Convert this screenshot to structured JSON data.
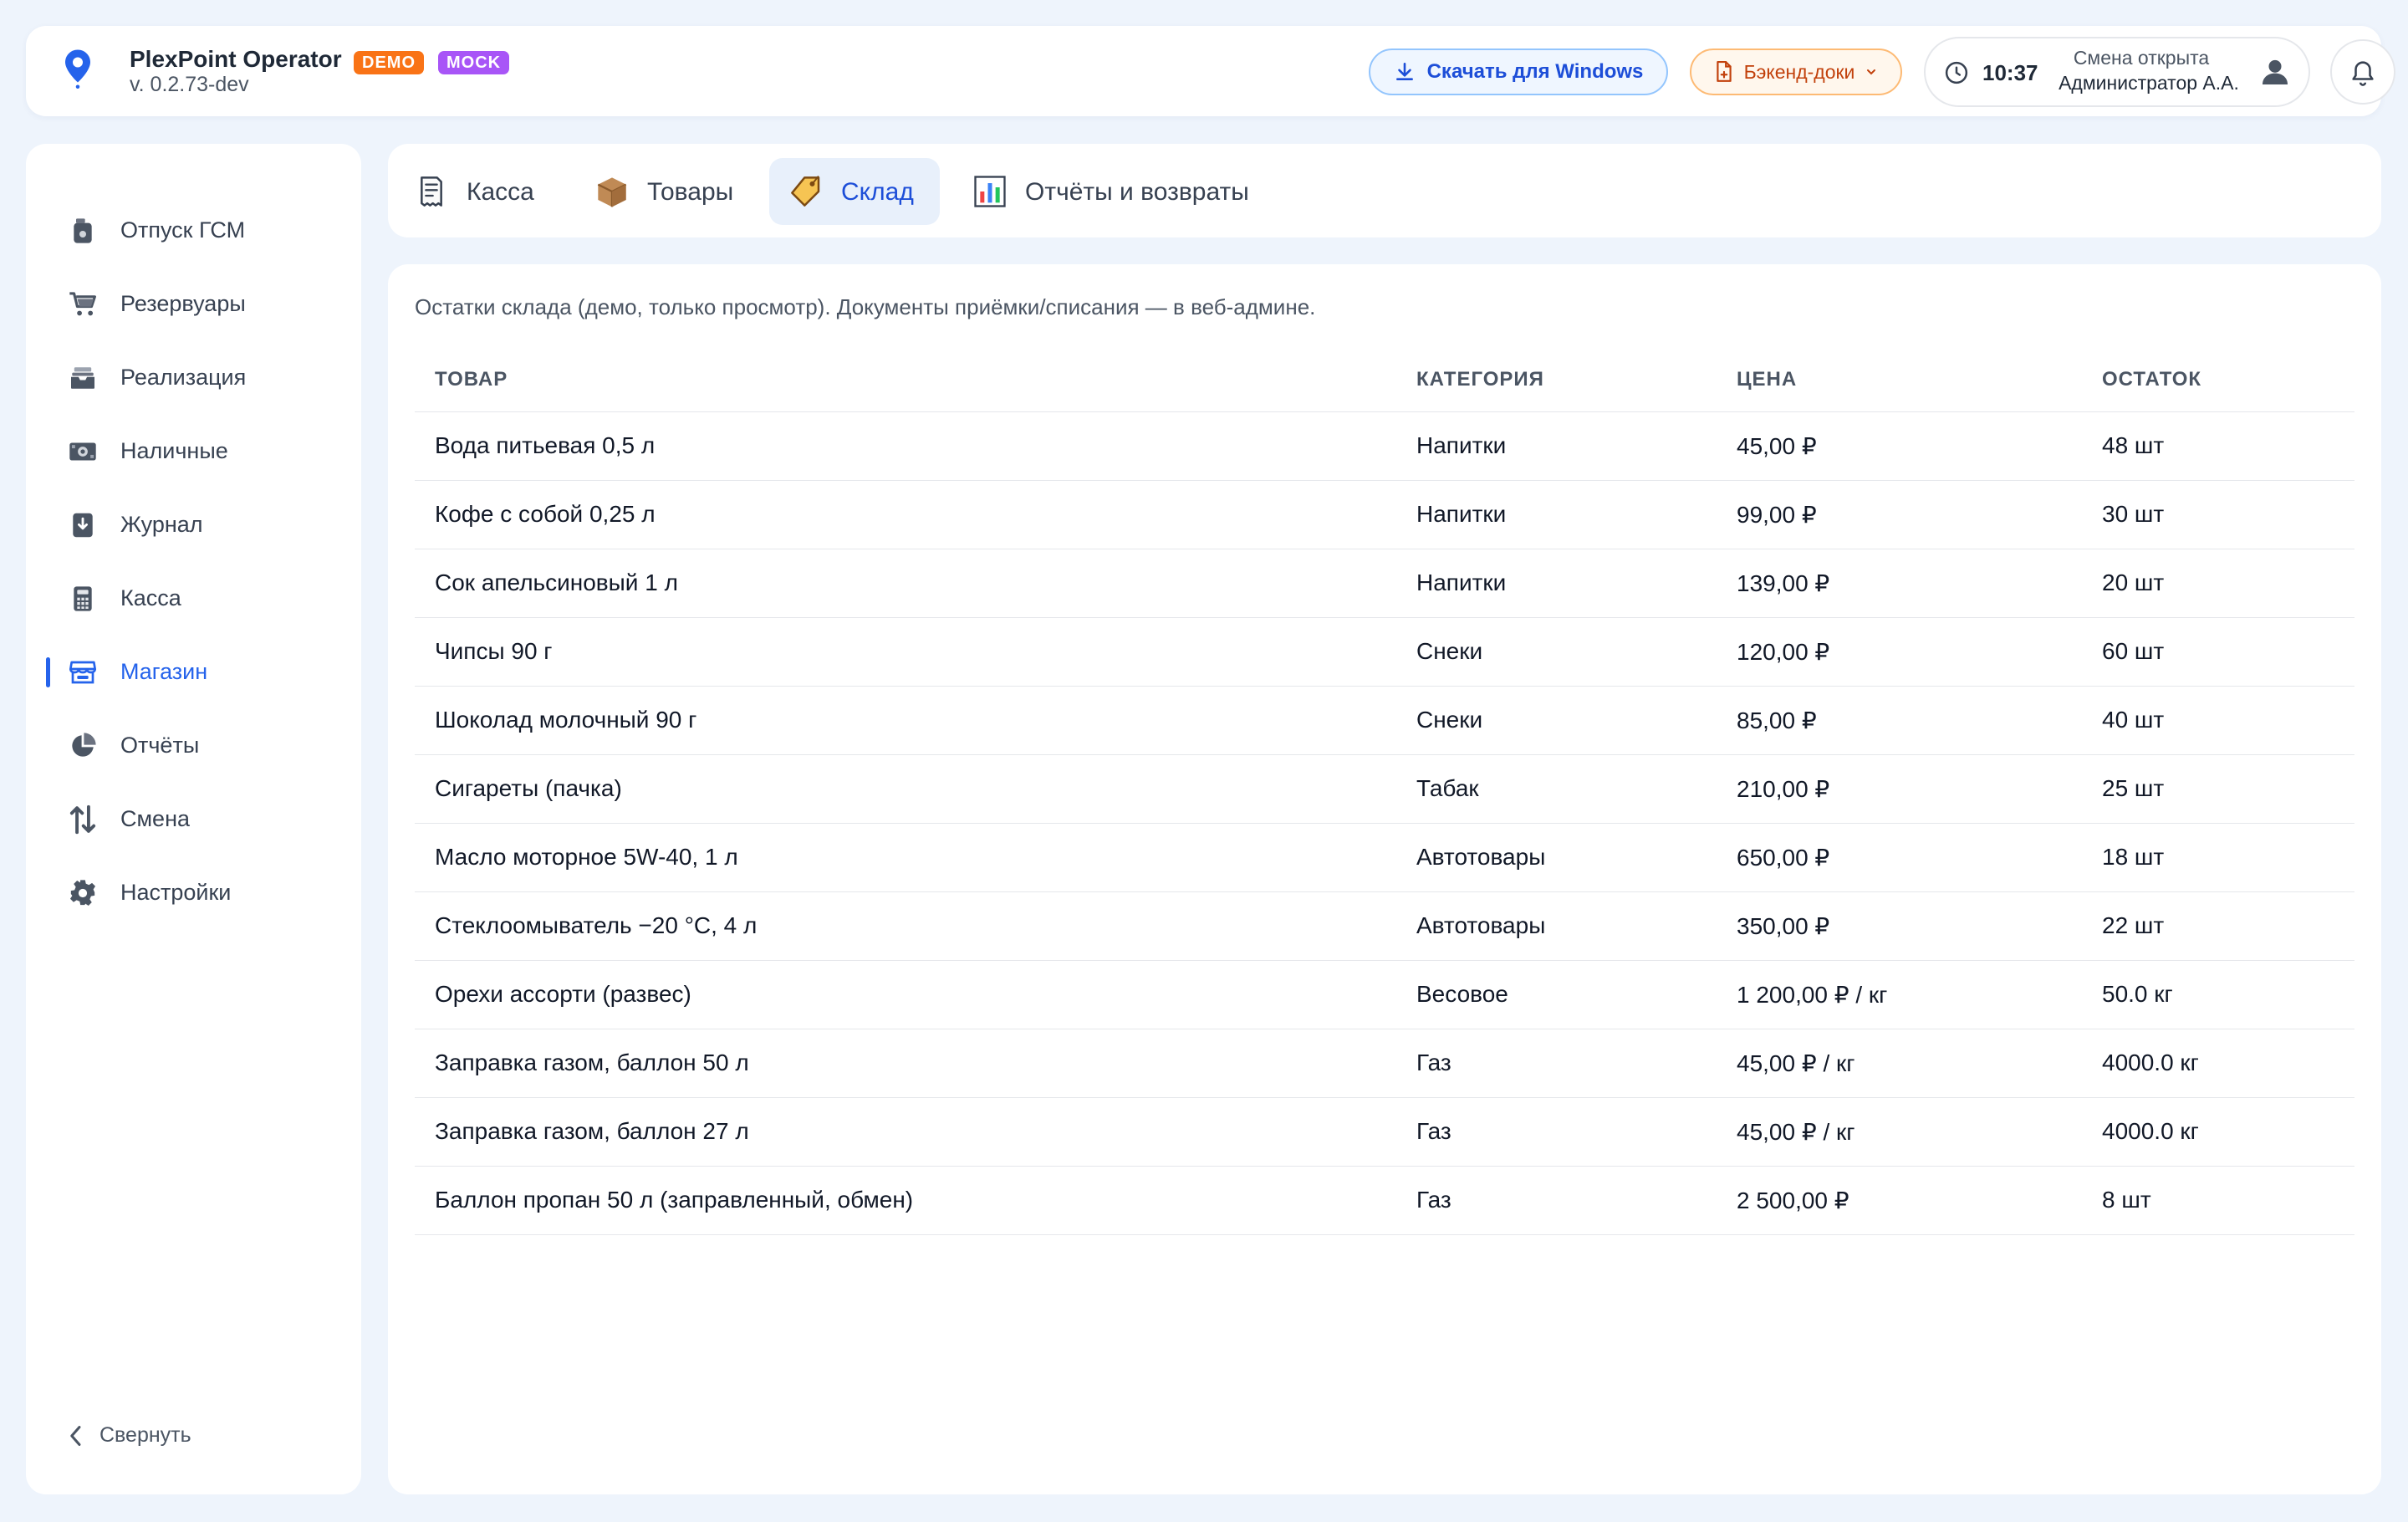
{
  "header": {
    "app_title": "PlexPoint Operator",
    "badge_demo": "DEMO",
    "badge_mock": "MOCK",
    "version": "v. 0.2.73-dev",
    "download_label": "Скачать для Windows",
    "docs_label": "Бэкенд-доки",
    "time": "10:37",
    "shift_status": "Смена открыта",
    "shift_user": "Администратор А.А.",
    "icons": {
      "logo": "map-pin-icon",
      "download": "download-icon",
      "docs": "document-icon",
      "clock": "clock-icon",
      "user": "user-icon",
      "bell": "bell-icon"
    }
  },
  "sidebar": {
    "items": [
      {
        "label": "Отпуск ГСМ",
        "icon": "fuel-canister-icon",
        "active": false
      },
      {
        "label": "Резервуары",
        "icon": "cart-icon",
        "active": false
      },
      {
        "label": "Реализация",
        "icon": "inbox-tray-icon",
        "active": false
      },
      {
        "label": "Наличные",
        "icon": "cash-icon",
        "active": false
      },
      {
        "label": "Журнал",
        "icon": "journal-icon",
        "active": false
      },
      {
        "label": "Касса",
        "icon": "calculator-icon",
        "active": false
      },
      {
        "label": "Магазин",
        "icon": "store-icon",
        "active": true
      },
      {
        "label": "Отчёты",
        "icon": "pie-chart-icon",
        "active": false
      },
      {
        "label": "Смена",
        "icon": "swap-arrows-icon",
        "active": false
      },
      {
        "label": "Настройки",
        "icon": "gear-icon",
        "active": false
      }
    ],
    "collapse_label": "Свернуть"
  },
  "tabs": [
    {
      "label": "Касса",
      "icon": "receipt-icon",
      "active": false
    },
    {
      "label": "Товары",
      "icon": "box-icon",
      "active": false
    },
    {
      "label": "Склад",
      "icon": "tag-icon",
      "active": true
    },
    {
      "label": "Отчёты и возвраты",
      "icon": "bar-chart-icon",
      "active": false
    }
  ],
  "panel": {
    "note": "Остатки склада (демо, только просмотр). Документы приёмки/списания — в веб-админе.",
    "columns": [
      "ТОВАР",
      "КАТЕГОРИЯ",
      "ЦЕНА",
      "ОСТАТОК"
    ],
    "rows": [
      [
        "Вода питьевая 0,5 л",
        "Напитки",
        "45,00 ₽",
        "48 шт"
      ],
      [
        "Кофе с собой 0,25 л",
        "Напитки",
        "99,00 ₽",
        "30 шт"
      ],
      [
        "Сок апельсиновый 1 л",
        "Напитки",
        "139,00 ₽",
        "20 шт"
      ],
      [
        "Чипсы 90 г",
        "Снеки",
        "120,00 ₽",
        "60 шт"
      ],
      [
        "Шоколад молочный 90 г",
        "Снеки",
        "85,00 ₽",
        "40 шт"
      ],
      [
        "Сигареты (пачка)",
        "Табак",
        "210,00 ₽",
        "25 шт"
      ],
      [
        "Масло моторное 5W-40, 1 л",
        "Автотовары",
        "650,00 ₽",
        "18 шт"
      ],
      [
        "Стеклоомыватель −20 °C, 4 л",
        "Автотовары",
        "350,00 ₽",
        "22 шт"
      ],
      [
        "Орехи ассорти (развес)",
        "Весовое",
        "1 200,00 ₽ / кг",
        "50.0 кг"
      ],
      [
        "Заправка газом, баллон 50 л",
        "Газ",
        "45,00 ₽ / кг",
        "4000.0 кг"
      ],
      [
        "Заправка газом, баллон 27 л",
        "Газ",
        "45,00 ₽ / кг",
        "4000.0 кг"
      ],
      [
        "Баллон пропан 50 л (заправленный, обмен)",
        "Газ",
        "2 500,00 ₽",
        "8 шт"
      ]
    ]
  },
  "colors": {
    "accent": "#2563eb",
    "background": "#eef4fc",
    "demo_badge": "#f97316",
    "mock_badge": "#a855f7"
  }
}
